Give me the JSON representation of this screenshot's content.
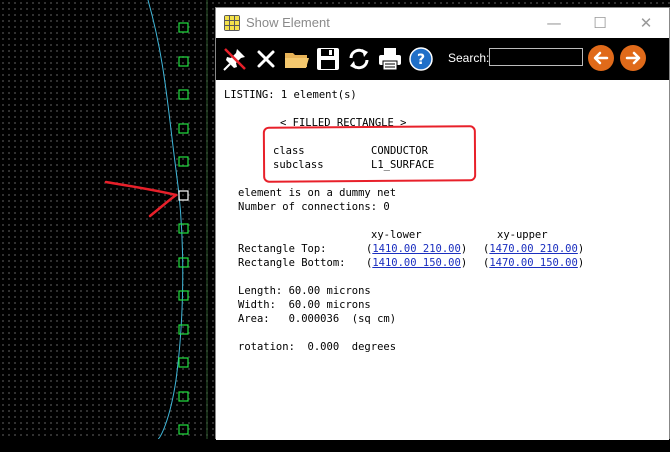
{
  "window": {
    "title": "Show Element",
    "minimize_glyph": "—",
    "maximize_glyph": "☐",
    "close_glyph": "✕"
  },
  "toolbar": {
    "icons": [
      "pin-icon",
      "close-x-icon",
      "folder-icon",
      "save-icon",
      "refresh-icon",
      "print-icon",
      "help-icon"
    ],
    "search_label": "Search:",
    "search_value": "",
    "accent_color": "#e06a1a"
  },
  "listing": {
    "header": "LISTING: 1 element(s)",
    "element_type": "< FILLED RECTANGLE >",
    "class_label": "class",
    "class_value": "CONDUCTOR",
    "subclass_label": "subclass",
    "subclass_value": "L1_SURFACE",
    "dummy_net": "element is on a dummy net",
    "connections": "Number of connections: 0",
    "col_lower": "xy-lower",
    "col_upper": "xy-upper",
    "rect_top_label": "Rectangle Top:",
    "rect_top_lower": "1410.00 210.00",
    "rect_top_upper": "1470.00 210.00",
    "rect_bottom_label": "Rectangle Bottom:",
    "rect_bottom_lower": "1410.00 150.00",
    "rect_bottom_upper": "1470.00 150.00",
    "length": "Length: 60.00 microns",
    "width": "Width:  60.00 microns",
    "area": "Area:   0.000036  (sq cm)",
    "rotation": "rotation:  0.000  degrees"
  },
  "colors": {
    "pad_green": "#22e040",
    "annotation_red": "#e8202a",
    "link_blue": "#1b2fbf"
  }
}
